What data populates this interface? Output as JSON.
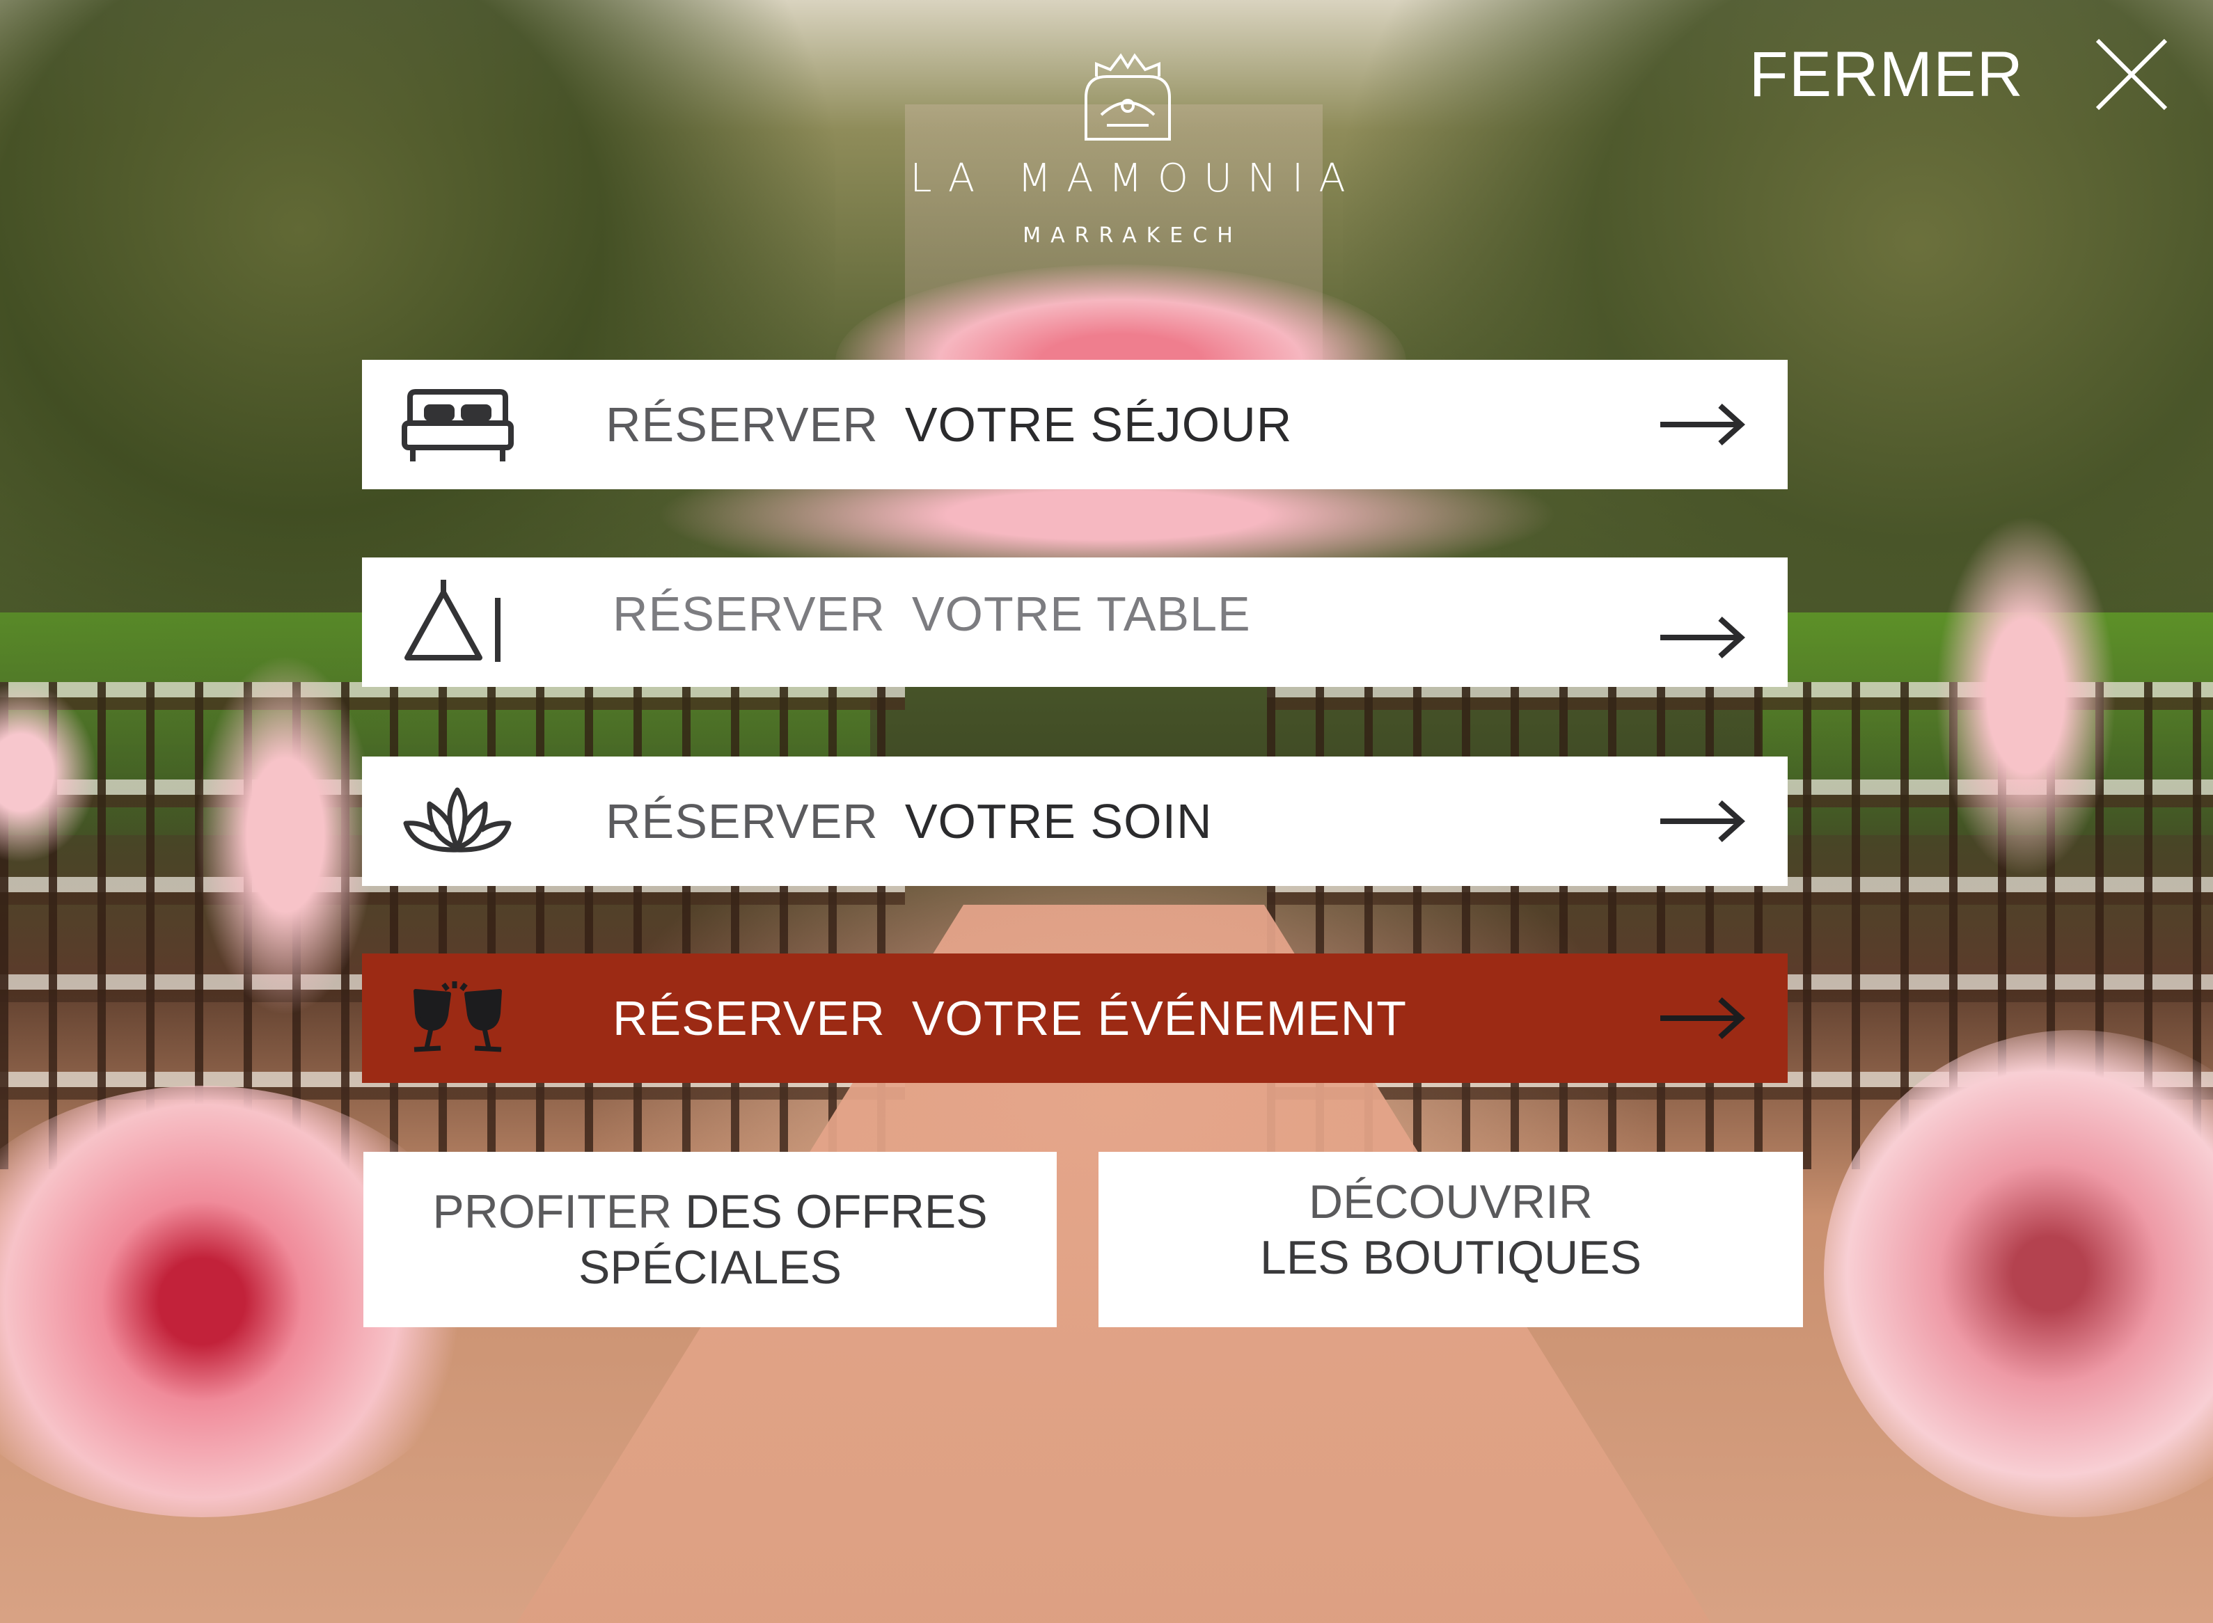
{
  "brand": {
    "name": "LA MAMOUNIA",
    "city": "MARRAKECH"
  },
  "close": {
    "label": "FERMER",
    "icon": "close-icon"
  },
  "menu": [
    {
      "id": "sejour",
      "prefix": "RÉSERVER",
      "label": "VOTRE SÉJOUR",
      "icon": "bed-icon"
    },
    {
      "id": "table",
      "prefix": "RÉSERVER",
      "label": "VOTRE TABLE",
      "icon": "dining-icon"
    },
    {
      "id": "soin",
      "prefix": "RÉSERVER",
      "label": "VOTRE SOIN",
      "icon": "lotus-icon"
    },
    {
      "id": "evenement",
      "prefix": "RÉSERVER",
      "label": "VOTRE ÉVÉNEMENT",
      "icon": "toast-glasses-icon",
      "highlighted": true
    }
  ],
  "tiles": {
    "offres": {
      "line1_prefix": "PROFITER",
      "line1_rest": "DES OFFRES",
      "line2": "SPÉCIALES"
    },
    "boutiques": {
      "line1": "DÉCOUVRIR",
      "line2": "LES BOUTIQUES"
    }
  },
  "colors": {
    "highlight": "#9c2a14",
    "panel": "#ffffff",
    "text": "#2f2f31"
  }
}
